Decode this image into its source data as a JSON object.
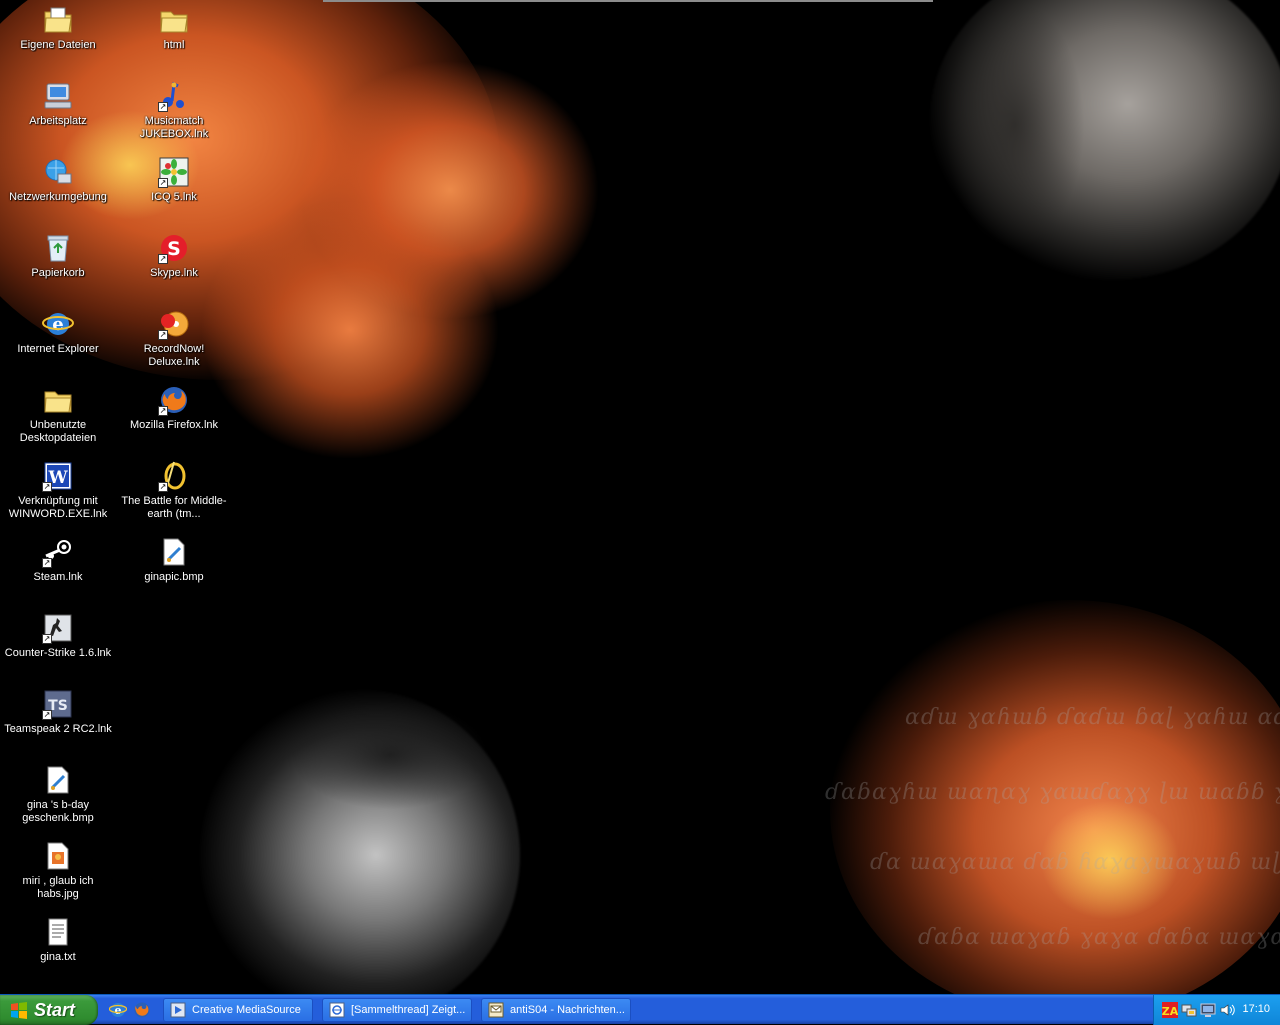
{
  "desktop": {
    "icons_col1": [
      {
        "label": "Eigene Dateien",
        "icon": "my-documents-icon"
      },
      {
        "label": "Arbeitsplatz",
        "icon": "my-computer-icon"
      },
      {
        "label": "Netzwerkumgebung",
        "icon": "network-places-icon"
      },
      {
        "label": "Papierkorb",
        "icon": "recycle-bin-icon"
      },
      {
        "label": "Internet Explorer",
        "icon": "internet-explorer-icon"
      },
      {
        "label": "Unbenutzte Desktopdateien",
        "icon": "folder-icon"
      },
      {
        "label": "Verknüpfung mit WINWORD.EXE.lnk",
        "icon": "word-icon"
      },
      {
        "label": "Steam.lnk",
        "icon": "steam-icon"
      },
      {
        "label": "Counter-Strike 1.6.lnk",
        "icon": "counter-strike-icon"
      },
      {
        "label": "Teamspeak 2 RC2.lnk",
        "icon": "teamspeak-icon"
      },
      {
        "label": "gina 's b-day geschenk.bmp",
        "icon": "bitmap-image-icon"
      },
      {
        "label": "miri , glaub ich habs.jpg",
        "icon": "jpeg-image-icon"
      },
      {
        "label": "gina.txt",
        "icon": "text-file-icon"
      }
    ],
    "icons_col2": [
      {
        "label": "html",
        "icon": "folder-icon"
      },
      {
        "label": "Musicmatch JUKEBOX.lnk",
        "icon": "musicmatch-icon"
      },
      {
        "label": "ICQ 5.lnk",
        "icon": "icq-icon"
      },
      {
        "label": "Skype.lnk",
        "icon": "skype-icon"
      },
      {
        "label": "RecordNow! Deluxe.lnk",
        "icon": "recordnow-icon"
      },
      {
        "label": "Mozilla Firefox.lnk",
        "icon": "firefox-icon"
      },
      {
        "label": "The Battle for Middle-earth (tm...",
        "icon": "battle-middle-earth-icon"
      },
      {
        "label": "ginapic.bmp",
        "icon": "bitmap-image-icon"
      }
    ]
  },
  "taskbar": {
    "start_label": "Start",
    "quick_launch": [
      {
        "icon": "internet-explorer-icon"
      },
      {
        "icon": "firefox-icon"
      }
    ],
    "tasks": [
      {
        "label": "Creative MediaSource",
        "icon": "media-source-icon"
      },
      {
        "label": "[Sammelthread] Zeigt...",
        "icon": "browser-window-icon"
      },
      {
        "label": "antiS04 - Nachrichten...",
        "icon": "messages-icon"
      }
    ],
    "tray_icons": [
      "zonealarm-icon",
      "network-tray-icon",
      "display-tray-icon",
      "volume-icon"
    ],
    "clock": "17:10"
  },
  "colors": {
    "taskbar_blue": "#245edb",
    "start_green": "#3b9a3b",
    "tray_blue": "#0f86d8",
    "flower_orange": "#f26a2a"
  }
}
